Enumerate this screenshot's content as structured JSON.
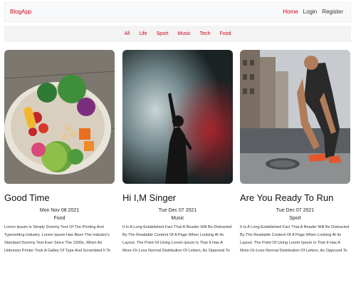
{
  "nav": {
    "brand": "BlogApp",
    "links": [
      "Home",
      "Login",
      "Register"
    ]
  },
  "categories": [
    "All",
    "Life",
    "Sport",
    "Music",
    "Tech",
    "Food"
  ],
  "posts": [
    {
      "title": "Good Time",
      "date": "Mon Nov 08 2021",
      "category": "Food",
      "excerpt": "Lorem Ipsum Is Simply Dummy Text Of The Printing And Typesetting Industry. Lorem Ipsum Has Been The Industry's Standard Dummy Text Ever Since The 1500s, When An Unknown Printer Took A Galley Of Type And Scrambled It To Make A Type Specimen Book. It Has Survived Not Only..."
    },
    {
      "title": "Hi I,M Singer",
      "date": "Tue Dec 07 2021",
      "category": "Music",
      "excerpt": "It Is A Long Established Fact That A Reader Will Be Distracted By The Readable Content Of A Page When Looking At Its Layout. The Point Of Using Lorem Ipsum Is That It Has A More-Or-Less Normal Distribution Of Letters, As Opposed To Using 'Content Here, Content Here', Making It Lo..."
    },
    {
      "title": "Are You Ready To Run",
      "date": "Tue Dec 07 2021",
      "category": "Sport",
      "excerpt": "It Is A Long Established Fact That A Reader Will Be Distracted By The Readable Content Of A Page When Looking At Its Layout. The Point Of Using Lorem Ipsum Is That It Has A More-Or-Less Normal Distribution Of Letters, As Opposed To Using 'Content Here, Content Here', Making It Lo..."
    }
  ],
  "colors": {
    "accent": "#d0021b",
    "navbar_bg": "#f8f9fa",
    "catbar_bg": "#f3f3f3"
  }
}
